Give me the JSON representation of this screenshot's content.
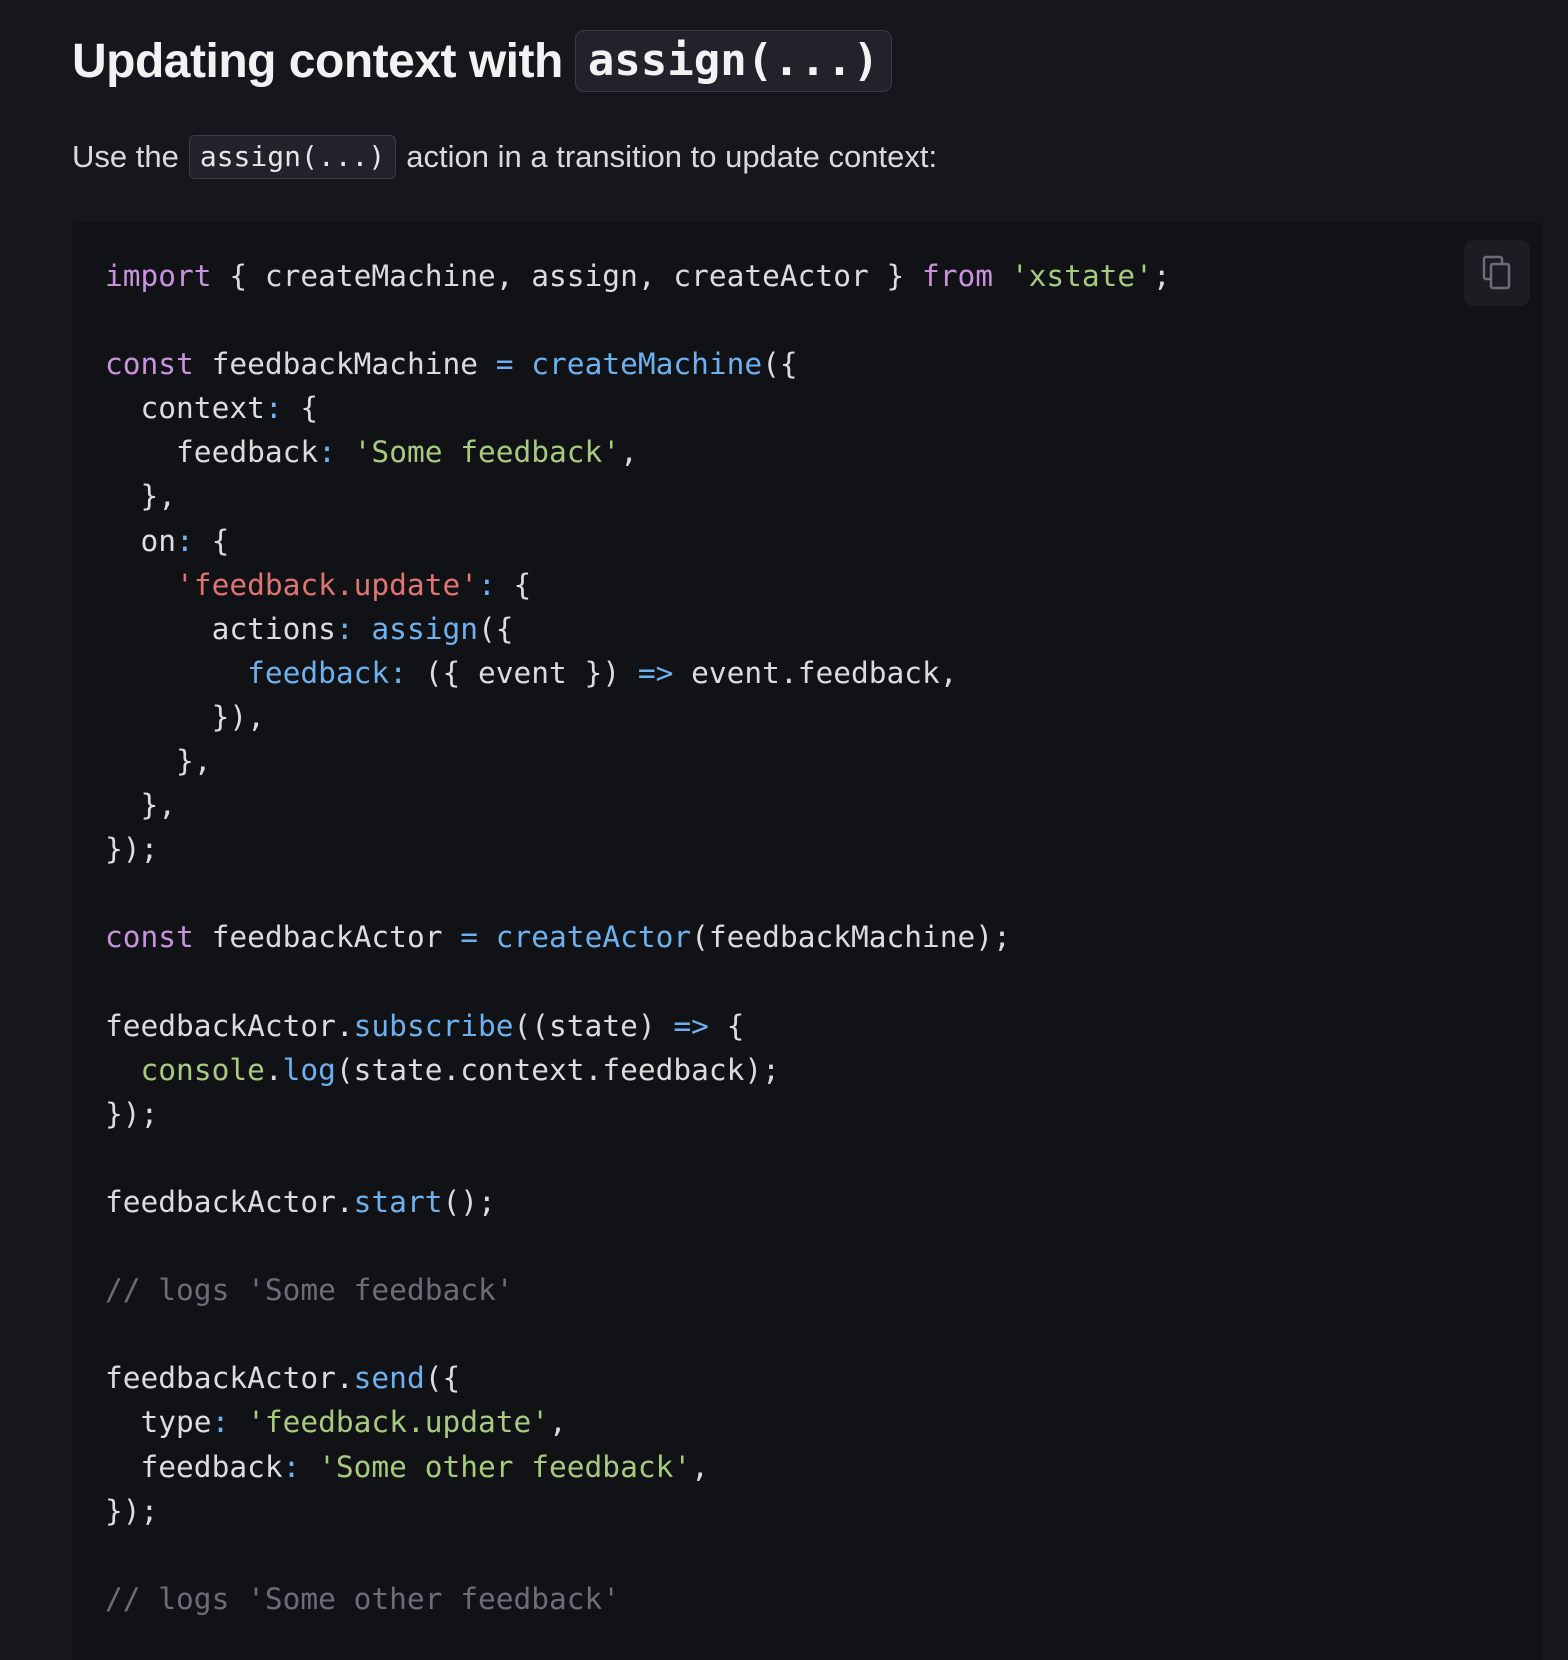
{
  "heading": {
    "text": "Updating context with",
    "code": "assign(...)"
  },
  "intro": {
    "before": "Use the",
    "code": "assign(...)",
    "after": "action in a transition to update context:"
  },
  "code_block": {
    "copy_icon": "copy-icon",
    "lines": [
      [
        {
          "t": "import",
          "c": "kw"
        },
        {
          "t": " { createMachine, assign, createActor } ",
          "c": "pl"
        },
        {
          "t": "from",
          "c": "kw"
        },
        {
          "t": " ",
          "c": "pl"
        },
        {
          "t": "'xstate'",
          "c": "str"
        },
        {
          "t": ";",
          "c": "pl"
        }
      ],
      [],
      [
        {
          "t": "const",
          "c": "kw"
        },
        {
          "t": " feedbackMachine ",
          "c": "pl"
        },
        {
          "t": "=",
          "c": "op"
        },
        {
          "t": " ",
          "c": "pl"
        },
        {
          "t": "createMachine",
          "c": "fn"
        },
        {
          "t": "({",
          "c": "pl"
        }
      ],
      [
        {
          "t": "  context",
          "c": "pl"
        },
        {
          "t": ":",
          "c": "op"
        },
        {
          "t": " {",
          "c": "pl"
        }
      ],
      [
        {
          "t": "    feedback",
          "c": "pl"
        },
        {
          "t": ":",
          "c": "op"
        },
        {
          "t": " ",
          "c": "pl"
        },
        {
          "t": "'Some feedback'",
          "c": "str"
        },
        {
          "t": ",",
          "c": "pl"
        }
      ],
      [
        {
          "t": "  },",
          "c": "pl"
        }
      ],
      [
        {
          "t": "  on",
          "c": "pl"
        },
        {
          "t": ":",
          "c": "op"
        },
        {
          "t": " {",
          "c": "pl"
        }
      ],
      [
        {
          "t": "    ",
          "c": "pl"
        },
        {
          "t": "'feedback.update'",
          "c": "key"
        },
        {
          "t": ":",
          "c": "op"
        },
        {
          "t": " {",
          "c": "pl"
        }
      ],
      [
        {
          "t": "      actions",
          "c": "pl"
        },
        {
          "t": ":",
          "c": "op"
        },
        {
          "t": " ",
          "c": "pl"
        },
        {
          "t": "assign",
          "c": "fn"
        },
        {
          "t": "({",
          "c": "pl"
        }
      ],
      [
        {
          "t": "        ",
          "c": "pl"
        },
        {
          "t": "feedback",
          "c": "fn"
        },
        {
          "t": ":",
          "c": "op"
        },
        {
          "t": " ({ event }) ",
          "c": "pl"
        },
        {
          "t": "=>",
          "c": "op"
        },
        {
          "t": " event.feedback,",
          "c": "pl"
        }
      ],
      [
        {
          "t": "      }),",
          "c": "pl"
        }
      ],
      [
        {
          "t": "    },",
          "c": "pl"
        }
      ],
      [
        {
          "t": "  },",
          "c": "pl"
        }
      ],
      [
        {
          "t": "});",
          "c": "pl"
        }
      ],
      [],
      [
        {
          "t": "const",
          "c": "kw"
        },
        {
          "t": " feedbackActor ",
          "c": "pl"
        },
        {
          "t": "=",
          "c": "op"
        },
        {
          "t": " ",
          "c": "pl"
        },
        {
          "t": "createActor",
          "c": "fn"
        },
        {
          "t": "(feedbackMachine);",
          "c": "pl"
        }
      ],
      [],
      [
        {
          "t": "feedbackActor.",
          "c": "pl"
        },
        {
          "t": "subscribe",
          "c": "fn"
        },
        {
          "t": "((state) ",
          "c": "pl"
        },
        {
          "t": "=>",
          "c": "op"
        },
        {
          "t": " {",
          "c": "pl"
        }
      ],
      [
        {
          "t": "  ",
          "c": "pl"
        },
        {
          "t": "console",
          "c": "obj"
        },
        {
          "t": ".",
          "c": "pl"
        },
        {
          "t": "log",
          "c": "fn"
        },
        {
          "t": "(state.context.feedback);",
          "c": "pl"
        }
      ],
      [
        {
          "t": "});",
          "c": "pl"
        }
      ],
      [],
      [
        {
          "t": "feedbackActor.",
          "c": "pl"
        },
        {
          "t": "start",
          "c": "fn"
        },
        {
          "t": "();",
          "c": "pl"
        }
      ],
      [],
      [
        {
          "t": "// logs 'Some feedback'",
          "c": "cm"
        }
      ],
      [],
      [
        {
          "t": "feedbackActor.",
          "c": "pl"
        },
        {
          "t": "send",
          "c": "fn"
        },
        {
          "t": "({",
          "c": "pl"
        }
      ],
      [
        {
          "t": "  type",
          "c": "pl"
        },
        {
          "t": ":",
          "c": "op"
        },
        {
          "t": " ",
          "c": "pl"
        },
        {
          "t": "'feedback.update'",
          "c": "str"
        },
        {
          "t": ",",
          "c": "pl"
        }
      ],
      [
        {
          "t": "  feedback",
          "c": "pl"
        },
        {
          "t": ":",
          "c": "op"
        },
        {
          "t": " ",
          "c": "pl"
        },
        {
          "t": "'Some other feedback'",
          "c": "str"
        },
        {
          "t": ",",
          "c": "pl"
        }
      ],
      [
        {
          "t": "});",
          "c": "pl"
        }
      ],
      [],
      [
        {
          "t": "// logs 'Some other feedback'",
          "c": "cm"
        }
      ]
    ]
  }
}
